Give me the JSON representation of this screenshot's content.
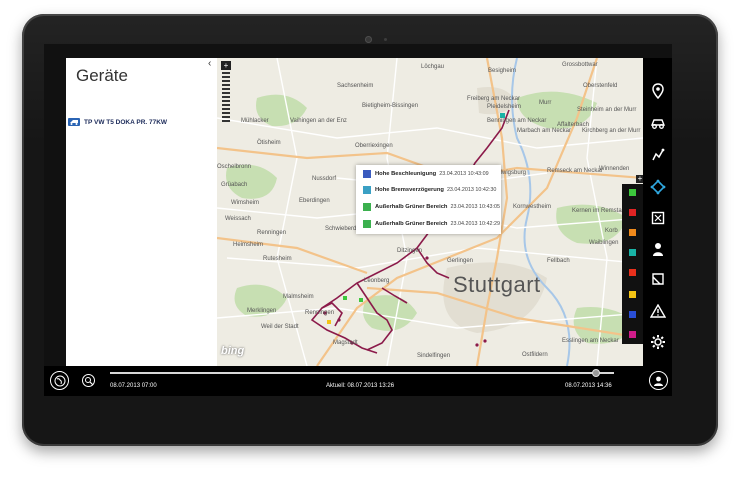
{
  "panel": {
    "title": "Geräte",
    "collapse_glyph": "‹",
    "devices": [
      {
        "label": "TP VW T5 DOKA PR. 77KW",
        "icon": "vehicle-icon"
      }
    ]
  },
  "map": {
    "zoom_in_glyph": "+",
    "provider": "bing",
    "labels": [
      {
        "text": "Löchgau"
      },
      {
        "text": "Besigheim"
      },
      {
        "text": "Grossbottwar"
      },
      {
        "text": "Oberstenfeld"
      },
      {
        "text": "Sachsenheim"
      },
      {
        "text": "Freiberg am Neckar"
      },
      {
        "text": "Bietigheim-Bissingen"
      },
      {
        "text": "Pleidelsheim"
      },
      {
        "text": "Murr"
      },
      {
        "text": "Steinheim an der Murr"
      },
      {
        "text": "Mühlacker"
      },
      {
        "text": "Vaihingen an der Enz"
      },
      {
        "text": "Benningen am Neckar"
      },
      {
        "text": "Affalterbach"
      },
      {
        "text": "Marbach am Neckar"
      },
      {
        "text": "Kirchberg an der Murr"
      },
      {
        "text": "Ötisheim"
      },
      {
        "text": "Oberriexingen"
      },
      {
        "text": "Ludwigsburg"
      },
      {
        "text": "Oschelbronn"
      },
      {
        "text": "Remseck am Neckar"
      },
      {
        "text": "Winnenden"
      },
      {
        "text": "Grüabach"
      },
      {
        "text": "Nussdorf"
      },
      {
        "text": "Wimsheim"
      },
      {
        "text": "Eberdingen"
      },
      {
        "text": "Kornwestheim"
      },
      {
        "text": "Weissach"
      },
      {
        "text": "Heimsheim"
      },
      {
        "text": "Fellbach"
      },
      {
        "text": "Kernen im Remstal"
      },
      {
        "text": "Schwieberdingen"
      },
      {
        "text": "Renningen"
      },
      {
        "text": "Korb"
      },
      {
        "text": "Waiblingen"
      },
      {
        "text": "Rutesheim"
      },
      {
        "text": "Ditzingen"
      },
      {
        "text": "Gerlingen"
      },
      {
        "text": "Leonberg"
      },
      {
        "text": "Stuttgart"
      },
      {
        "text": "Malmsheim"
      },
      {
        "text": "Renningen"
      },
      {
        "text": "Merklingen"
      },
      {
        "text": "Weil der Stadt"
      },
      {
        "text": "Magstadt"
      },
      {
        "text": "Sindelfingen"
      },
      {
        "text": "Esslingen am Neckar"
      },
      {
        "text": "Ostfildern"
      }
    ]
  },
  "popup": {
    "items": [
      {
        "title": "Hohe Beschleunigung",
        "time": "23.04.2013 10:43:09",
        "color": "#3a5bbf"
      },
      {
        "title": "Hohe Bremsverzögerung",
        "time": "23.04.2013 10:42:30",
        "color": "#3aa0c4"
      },
      {
        "title": "Außerhalb Grüner Bereich",
        "time": "23.04.2013 10:43:05",
        "color": "#3bb04e"
      },
      {
        "title": "Außerhalb Grüner Bereich",
        "time": "23.04.2013 10:42:29",
        "color": "#3bb04e"
      }
    ]
  },
  "legend": {
    "expand_glyph": "+",
    "colors": [
      "#3cc73c",
      "#e02424",
      "#f08a1c",
      "#19b3a6",
      "#e8301c",
      "#f4c414",
      "#2a4fd6",
      "#d01c8a"
    ]
  },
  "appbar": {
    "buttons": [
      "location-pin-icon",
      "vehicle-route-icon",
      "map-poi-icon",
      "geofence-icon",
      "area-select-icon",
      "driver-icon",
      "layers-icon",
      "warning-icon",
      "settings-gear-icon"
    ]
  },
  "timeline": {
    "start": "08.07.2013 07:00",
    "current": "Aktuell: 08.07.2013 13:26",
    "end": "08.07.2013 14:36",
    "position": 0.965
  },
  "bottombar": {
    "left_buttons": [
      "globe-icon",
      "search-magnifier-icon"
    ],
    "right_button": "user-avatar-icon"
  },
  "colors": {
    "route": "#8b1a4a",
    "map_background": "#eeece3",
    "road_major": "#f3c38a",
    "forest": "#c7dfb2"
  }
}
